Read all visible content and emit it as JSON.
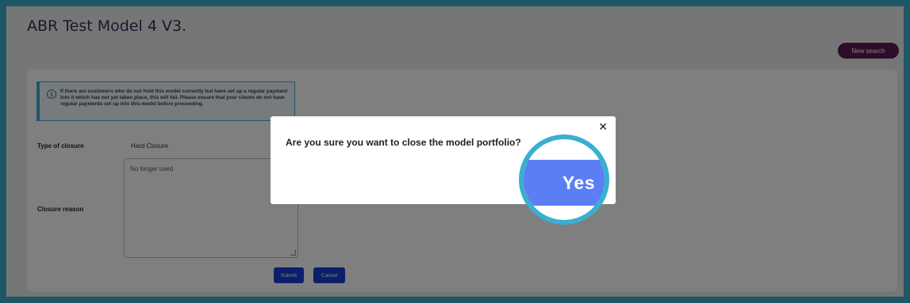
{
  "page": {
    "title": "ABR Test Model 4 V3."
  },
  "header": {
    "new_search_label": "New search"
  },
  "info": {
    "message": "If there are customers who do not hold this model currently but have set up a regular payment into it which has not yet taken place, this will fail. Please ensure that your clients do not have regular payments set up into this model before proceeding."
  },
  "form": {
    "type_of_closure_label": "Type of closure",
    "type_of_closure_value": "Hard Closure",
    "closure_reason_label": "Closure reason",
    "closure_reason_value": "No longer used",
    "submit_label": "Submit",
    "cancel_label": "Cancel"
  },
  "modal": {
    "question": "Are you sure you want to close the model portfolio?",
    "close_glyph": "✕",
    "yes_label": "Yes"
  },
  "colors": {
    "accent": "#3aafcf",
    "brand": "#5a1a54",
    "primary_button": "#1a3fd6"
  },
  "icons": [
    "info-icon",
    "close-icon"
  ]
}
